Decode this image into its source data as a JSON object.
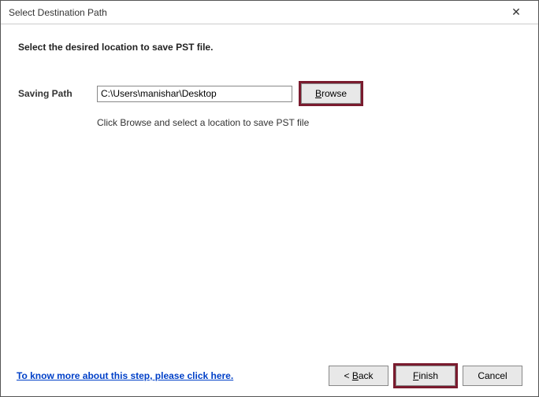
{
  "titlebar": {
    "title": "Select Destination Path"
  },
  "heading": "Select the desired location to save PST file.",
  "form": {
    "saving_path_label": "Saving Path",
    "saving_path_value": "C:\\Users\\manishar\\Desktop",
    "browse_prefix": "B",
    "browse_rest": "rowse",
    "hint": "Click Browse and select a location to save PST file"
  },
  "footer": {
    "help_link": "To know more about this step, please click here.",
    "back_prefix": "< ",
    "back_u": "B",
    "back_rest": "ack",
    "finish_u": "F",
    "finish_rest": "inish",
    "cancel": "Cancel"
  },
  "colors": {
    "highlight_border": "#7a1b2e",
    "link": "#0040c8"
  }
}
